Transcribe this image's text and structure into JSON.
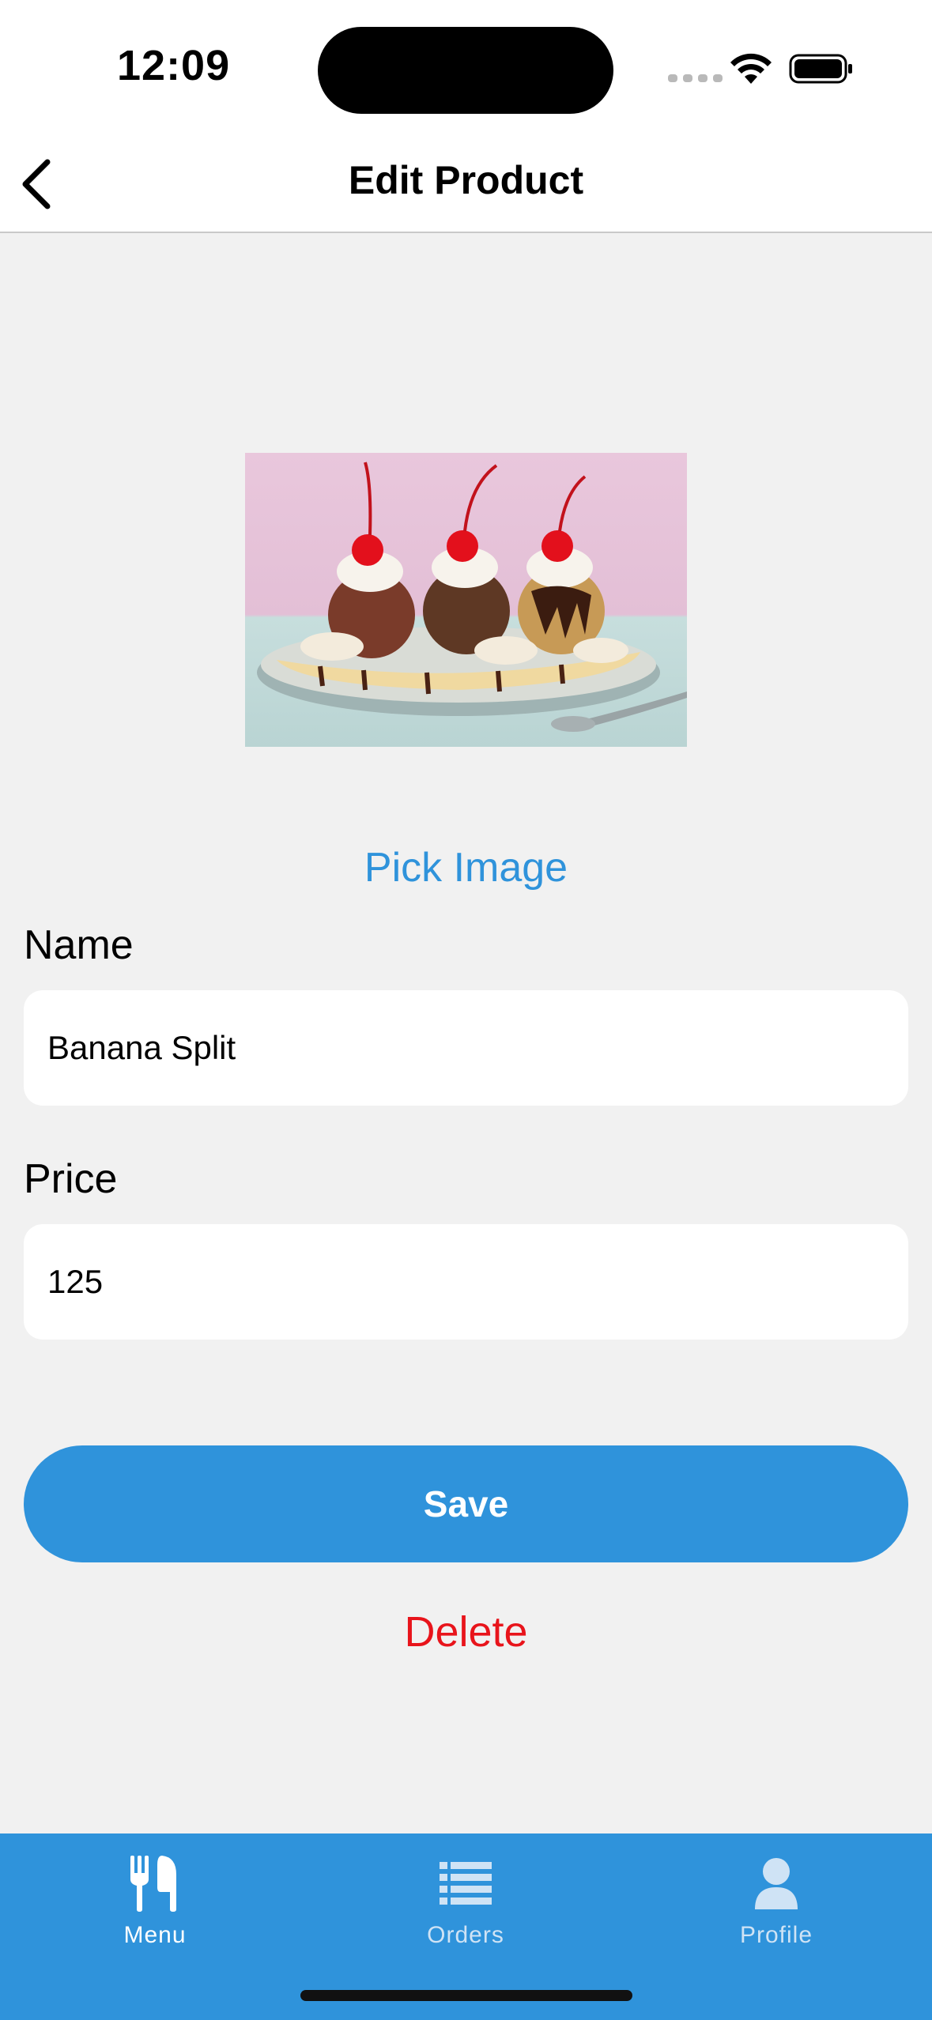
{
  "status_bar": {
    "time": "12:09"
  },
  "nav": {
    "title": "Edit Product"
  },
  "product_image": {
    "alt": "Banana split dessert"
  },
  "actions": {
    "pick_image": "Pick Image",
    "save": "Save",
    "delete": "Delete"
  },
  "form": {
    "name_label": "Name",
    "name_value": "Banana Split",
    "price_label": "Price",
    "price_value": "125"
  },
  "tabs": [
    {
      "label": "Menu",
      "icon": "fork-knife-icon",
      "active": true
    },
    {
      "label": "Orders",
      "icon": "list-icon",
      "active": false
    },
    {
      "label": "Profile",
      "icon": "person-icon",
      "active": false
    }
  ],
  "colors": {
    "accent": "#2f93db",
    "danger": "#e8141b",
    "background": "#f1f1f1"
  }
}
